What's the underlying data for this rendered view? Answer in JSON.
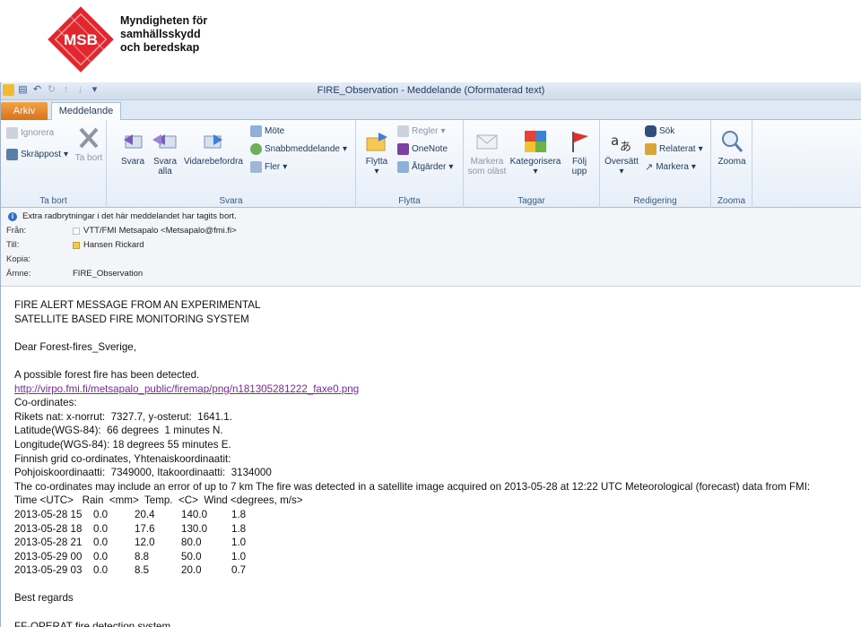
{
  "logo": {
    "mark": "MSB",
    "line1": "Myndigheten för",
    "line2": "samhällsskydd",
    "line3": "och beredskap"
  },
  "window": {
    "title": "FIRE_Observation  -  Meddelande (Oformaterad text)"
  },
  "tabs": {
    "file": "Arkiv",
    "message": "Meddelande"
  },
  "ribbon": {
    "ta_bort": {
      "label": "Ta bort",
      "ignore": "Ignorera",
      "junk": "Skräppost",
      "delete": "Ta bort"
    },
    "svara": {
      "label": "Svara",
      "reply": "Svara",
      "reply_all": "Svara alla",
      "forward": "Vidarebefordra",
      "meeting": "Möte",
      "im": "Snabbmeddelande",
      "more": "Fler"
    },
    "flytta": {
      "label": "Flytta",
      "move": "Flytta",
      "rules": "Regler",
      "onenote": "OneNote",
      "actions": "Åtgärder"
    },
    "taggar": {
      "label": "Taggar",
      "mark_unread": "Markera som oläst",
      "categorize": "Kategorisera",
      "follow_up": "Följ upp"
    },
    "redigering": {
      "label": "Redigering",
      "translate": "Översätt",
      "find": "Sök",
      "related": "Relaterat",
      "select": "Markera"
    },
    "zoom": {
      "label": "Zooma",
      "zoom": "Zooma"
    }
  },
  "header": {
    "info_message": "Extra radbrytningar i det här meddelandet har tagits bort.",
    "from_label": "Från:",
    "from_value": "VTT/FMI Metsapalo <Metsapalo@fmi.fi>",
    "to_label": "Till:",
    "to_value": "Hansen Rickard",
    "cc_label": "Kopia:",
    "subject_label": "Ämne:",
    "subject_value": "FIRE_Observation"
  },
  "body": {
    "heading1": "FIRE ALERT MESSAGE FROM AN EXPERIMENTAL",
    "heading2": "SATELLITE BASED FIRE MONITORING SYSTEM",
    "greeting": "Dear Forest-fires_Sverige,",
    "detected": "A possible forest fire has been detected.",
    "link": "http://virpo.fmi.fi/metsapalo_public/firemap/png/n181305281222_faxe0.png",
    "coords_heading": "Co-ordinates:",
    "rikets": "Rikets nat: x-norrut:  7327.7, y-osterut:  1641.1.",
    "latitude": "Latitude(WGS-84):  66 degrees  1 minutes N.",
    "longitude": "Longitude(WGS-84): 18 degrees 55 minutes E.",
    "finnish_grid": "Finnish grid co-ordinates, Yhtenaiskoordinaatit:",
    "pohjois": "Pohjoiskoordinaatti:  7349000, Itakoordinaatti:  3134000",
    "error_note": "The co-ordinates may include an error of up to 7 km The fire was detected in a satellite image acquired on 2013-05-28 at 12:22 UTC Meteorological (forecast) data from FMI:",
    "table_header": "Time <UTC>   Rain  <mm>  Temp.  <C>  Wind <degrees, m/s>",
    "weather_rows": [
      {
        "time": "2013-05-28 15",
        "rain": "0.0",
        "temp": "20.4",
        "dir": "140.0",
        "speed": "1.8"
      },
      {
        "time": "2013-05-28 18",
        "rain": "0.0",
        "temp": "17.6",
        "dir": "130.0",
        "speed": "1.8"
      },
      {
        "time": "2013-05-28 21",
        "rain": "0.0",
        "temp": "12.0",
        "dir": "80.0",
        "speed": "1.0"
      },
      {
        "time": "2013-05-29 00",
        "rain": "0.0",
        "temp": "8.8",
        "dir": "50.0",
        "speed": "1.0"
      },
      {
        "time": "2013-05-29 03",
        "rain": "0.0",
        "temp": "8.5",
        "dir": "20.0",
        "speed": "0.7"
      }
    ],
    "regards": "Best regards",
    "signature": "FF-OPERAT fire detection system,"
  },
  "colors": {
    "msb_red": "#e1262d",
    "file_tab": "#d9711a",
    "link": "#7a2a9a"
  }
}
